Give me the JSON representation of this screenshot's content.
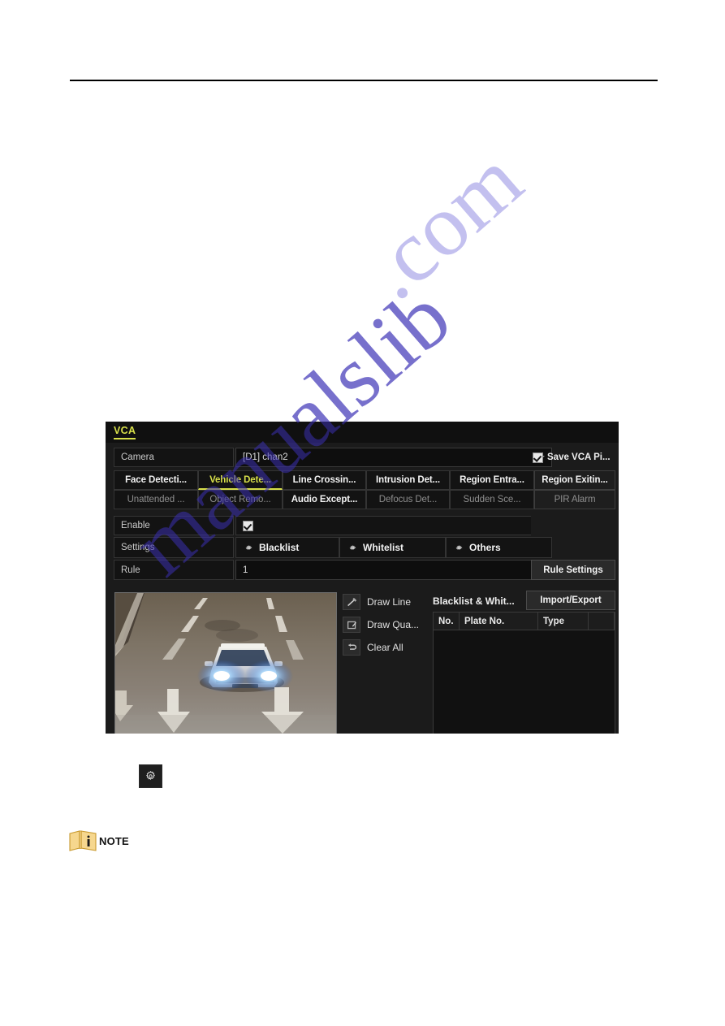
{
  "page": {
    "background_color": "#ffffff",
    "rule_color": "#000000",
    "watermark_text_primary": "manualslib",
    "watermark_text_secondary": ".com",
    "watermark_color": "#c3c0ef"
  },
  "vca_dialog": {
    "title": "VCA",
    "accent_color": "#d8e04a",
    "camera": {
      "label": "Camera",
      "value": "[D1] chan2"
    },
    "save_vca_picture": {
      "label": "Save VCA Pi...",
      "checked": true
    },
    "detection_tabs": [
      {
        "label": "Face Detecti...",
        "state": "normal"
      },
      {
        "label": "Vehicle Dete...",
        "state": "active"
      },
      {
        "label": "Line Crossin...",
        "state": "normal"
      },
      {
        "label": "Intrusion Det...",
        "state": "normal"
      },
      {
        "label": "Region Entra...",
        "state": "normal"
      },
      {
        "label": "Unattended ...",
        "state": "dim"
      },
      {
        "label": "Object Remo...",
        "state": "dim"
      },
      {
        "label": "Audio Except...",
        "state": "normal"
      },
      {
        "label": "Defocus Det...",
        "state": "dim"
      },
      {
        "label": "Sudden Sce...",
        "state": "dim"
      }
    ],
    "side_tabs": [
      {
        "label": "Region Exitin...",
        "state": "normal"
      },
      {
        "label": "PIR Alarm",
        "state": "dim"
      }
    ],
    "enable": {
      "label": "Enable",
      "checked": true
    },
    "settings": {
      "label": "Settings",
      "options": [
        {
          "label": "Blacklist",
          "icon": "gear-icon"
        },
        {
          "label": "Whitelist",
          "icon": "gear-icon"
        },
        {
          "label": "Others",
          "icon": "gear-icon"
        }
      ]
    },
    "rule": {
      "label": "Rule",
      "value": "1",
      "settings_button": "Rule Settings"
    },
    "draw_tools": [
      {
        "label": "Draw Line",
        "icon": "draw-line-icon"
      },
      {
        "label": "Draw Qua...",
        "icon": "draw-quad-icon"
      },
      {
        "label": "Clear All",
        "icon": "clear-all-icon"
      }
    ],
    "list_panel": {
      "tab_label": "Blacklist & Whit...",
      "import_export_button": "Import/Export",
      "columns": [
        "No.",
        "Plate No.",
        "Type"
      ],
      "rows": []
    },
    "preview": {
      "description": "night road scene with white car headlights on"
    }
  },
  "below_dialog": {
    "gear_button_icon": "gear-icon",
    "note_label": "NOTE",
    "note_icon": "note-book-icon"
  }
}
